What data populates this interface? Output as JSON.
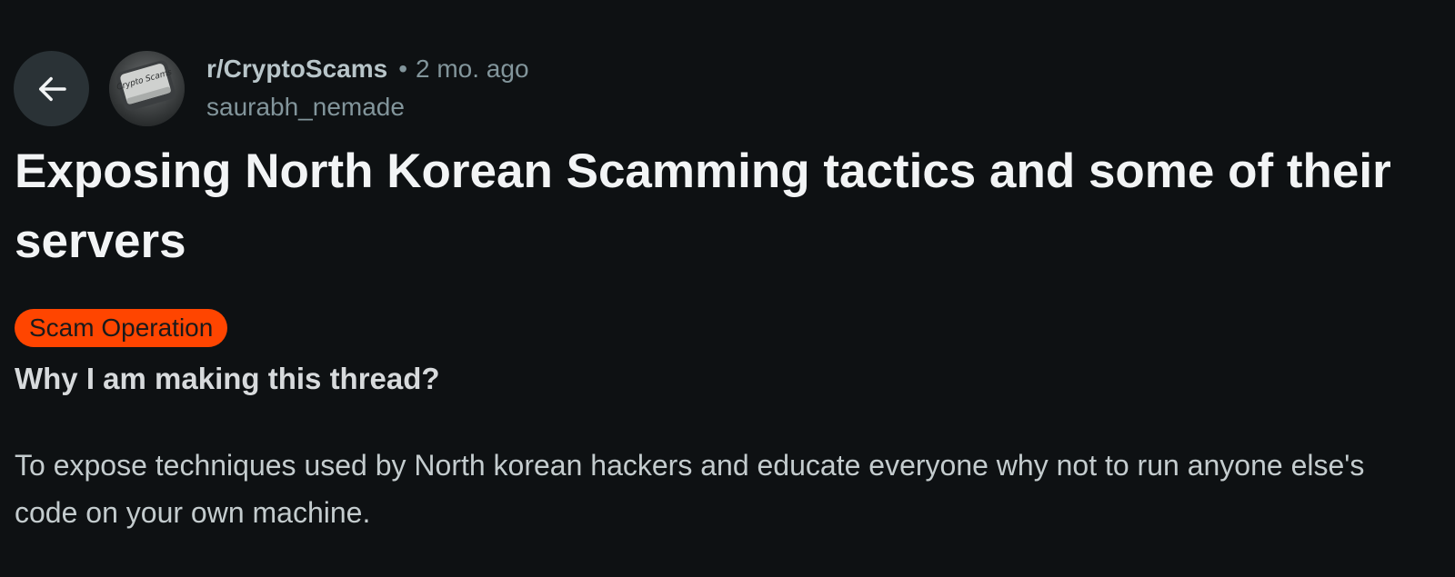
{
  "header": {
    "back_icon": "arrow-left-icon",
    "avatar_icon": "crypto-scams-keycap-icon",
    "avatar_text": "Crypto Scams",
    "subreddit": "r/CryptoScams",
    "separator": "•",
    "time_ago": "2 mo. ago",
    "author": "saurabh_nemade"
  },
  "post": {
    "title": "Exposing North Korean Scamming tactics and some of their servers",
    "flair": "Scam Operation",
    "subheading": "Why I am making this thread?",
    "body": "To expose techniques used by North korean hackers and educate everyone why not to run anyone else's code on your own machine."
  },
  "colors": {
    "background": "#0e1113",
    "flair_bg": "#ff4500",
    "back_button_bg": "#2a3236"
  }
}
